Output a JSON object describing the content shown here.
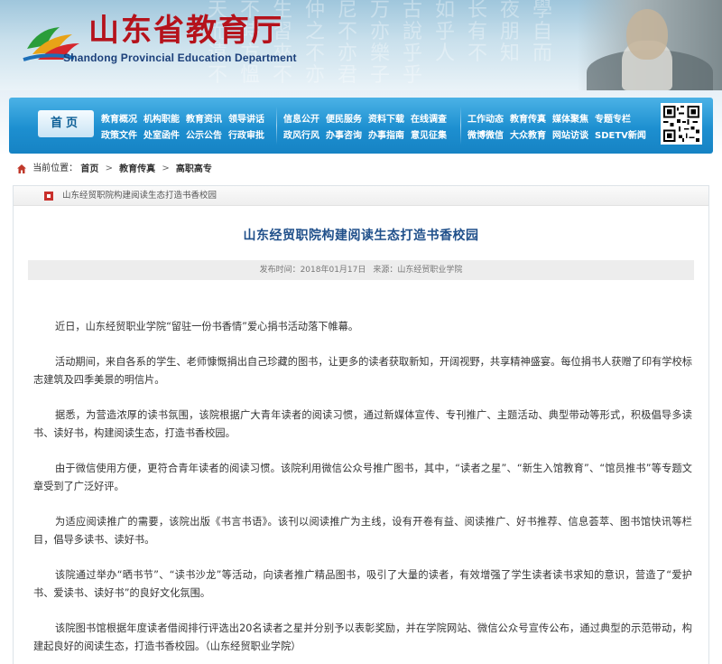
{
  "header": {
    "title": "山东省教育厅",
    "subtitle": "Shandong Provincial Education Department",
    "background_glyphs": "天不生仲尼万古如长夜學而時習之不亦說乎有朋自遠方來不亦樂乎人不知而不慍不亦君子乎",
    "title_color": "#b5121b"
  },
  "nav": {
    "home_label": "首页",
    "group1": [
      [
        "教育概况",
        "机构职能",
        "教育资讯",
        "领导讲话"
      ],
      [
        "政策文件",
        "处室函件",
        "公示公告",
        "行政审批"
      ]
    ],
    "group2": [
      [
        "信息公开",
        "便民服务",
        "资料下载",
        "在线调查"
      ],
      [
        "政风行风",
        "办事咨询",
        "办事指南",
        "意见征集"
      ]
    ],
    "group3": [
      [
        "工作动态",
        "教育传真",
        "媒体聚焦",
        "专题专栏"
      ],
      [
        "微博微信",
        "大众教育",
        "网站访谈",
        "SDETV新闻"
      ]
    ],
    "accent": "#1d8fd0"
  },
  "breadcrumb": {
    "prefix": "当前位置：",
    "items": [
      "首页",
      "教育传真",
      "高职高专"
    ],
    "separator": ">"
  },
  "content": {
    "head_label": "山东经贸职院构建阅读生态打造书香校园",
    "title": "山东经贸职院构建阅读生态打造书香校园",
    "meta_date": "发布时间：2018年01月17日",
    "meta_source": "来源：山东经贸职业学院",
    "paragraphs": [
      "近日，山东经贸职业学院“留驻一份书香情”爱心捐书活动落下帷幕。",
      "活动期间，来自各系的学生、老师慷慨捐出自己珍藏的图书，让更多的读者获取新知，开阔视野，共享精神盛宴。每位捐书人获赠了印有学校标志建筑及四季美景的明信片。",
      "据悉，为营造浓厚的读书氛围，该院根据广大青年读者的阅读习惯，通过新媒体宣传、专刊推广、主题活动、典型带动等形式，积极倡导多读书、读好书，构建阅读生态，打造书香校园。",
      "由于微信使用方便，更符合青年读者的阅读习惯。该院利用微信公众号推广图书，其中，“读者之星”、“新生入馆教育”、“馆员推书”等专题文章受到了广泛好评。",
      "为适应阅读推广的需要，该院出版《书言书语》。该刊以阅读推广为主线，设有开卷有益、阅读推广、好书推荐、信息荟萃、图书馆快讯等栏目，倡导多读书、读好书。",
      "该院通过举办“晒书节”、“读书沙龙”等活动，向读者推广精品图书，吸引了大量的读者，有效增强了学生读者读书求知的意识，营造了“爱护书、爱读书、读好书”的良好文化氛围。",
      "该院图书馆根据年度读者借阅排行评选出20名读者之星并分别予以表彰奖励，并在学院网站、微信公众号宣传公布，通过典型的示范带动，构建起良好的阅读生态，打造书香校园。（山东经贸职业学院）"
    ],
    "title_color": "#1f4f8a"
  }
}
